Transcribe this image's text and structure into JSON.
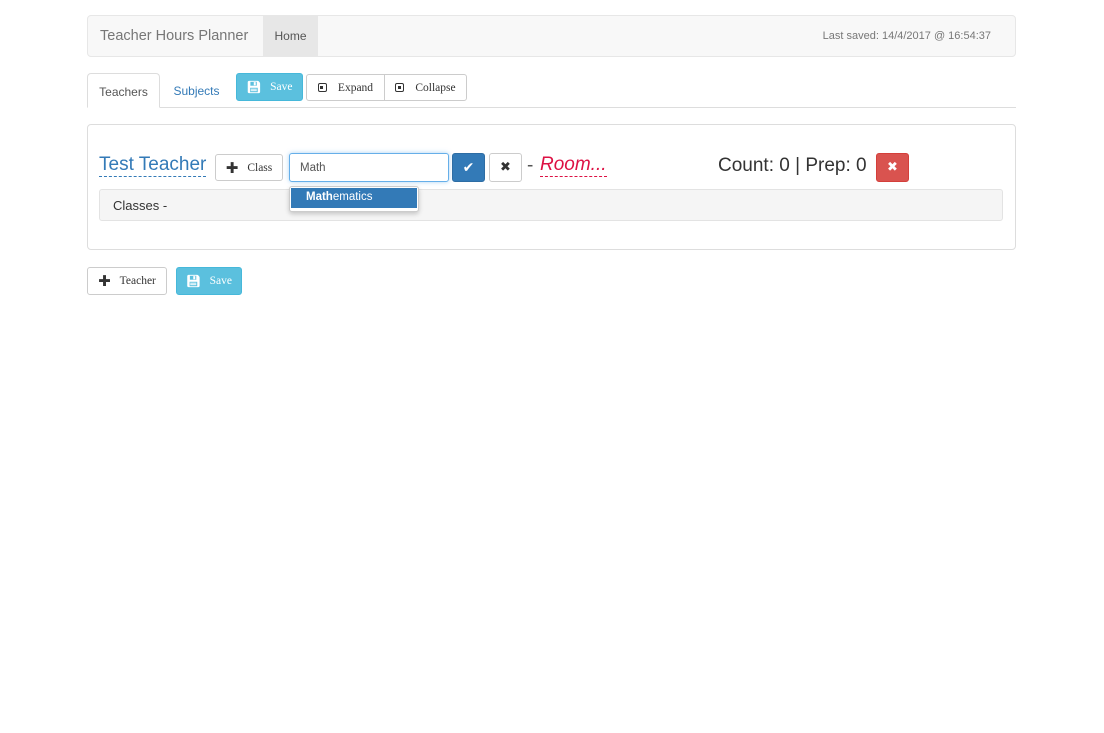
{
  "navbar": {
    "brand": "Teacher Hours Planner",
    "home": "Home",
    "last_saved": "Last saved: 14/4/2017 @ 16:54:37"
  },
  "tabs": [
    {
      "label": "Teachers",
      "active": true
    },
    {
      "label": "Subjects",
      "active": false
    }
  ],
  "toolbar": {
    "save_label": "Save",
    "expand_label": "Expand",
    "collapse_label": "Collapse"
  },
  "teacher": {
    "name": "Test Teacher",
    "add_class_label": "Class",
    "subject_input_value": "Math",
    "separator": "-",
    "room_placeholder": "Room...",
    "counts": "Count: 0 | Prep: 0",
    "classes_label": "Classes -"
  },
  "autocomplete": {
    "match": "Math",
    "rest": "ematics"
  },
  "footer": {
    "add_teacher_label": "Teacher",
    "save_label": "Save"
  },
  "colors": {
    "primary": "#337ab7",
    "info": "#5bc0de",
    "danger": "#d9534f",
    "room_text": "#dd1144"
  }
}
